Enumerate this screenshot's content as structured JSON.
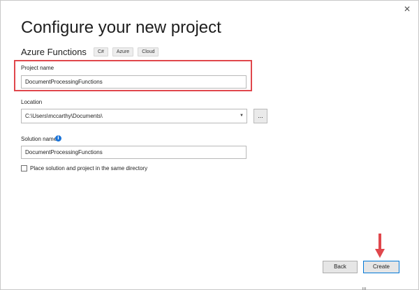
{
  "window": {
    "close_glyph": "✕"
  },
  "header": {
    "title": "Configure your new project",
    "template_name": "Azure Functions",
    "tags": [
      "C#",
      "Azure",
      "Cloud"
    ]
  },
  "form": {
    "project_name": {
      "label": "Project name",
      "value": "DocumentProcessingFunctions"
    },
    "location": {
      "label": "Location",
      "value": "C:\\Users\\mccarthy\\Documents\\",
      "browse_label": "...",
      "dropdown_icon": "chevron-down-icon"
    },
    "solution_name": {
      "label": "Solution name",
      "value": "DocumentProcessingFunctions",
      "info_icon": "info-icon",
      "info_glyph": "i"
    },
    "same_directory": {
      "label": "Place solution and project in the same directory",
      "checked": false
    }
  },
  "footer": {
    "back_label": "Back",
    "create_label": "Create"
  },
  "annotation": {
    "highlight_color": "#e0474c",
    "arrow_color": "#e0474c"
  },
  "colors": {
    "accent": "#0078d7",
    "info": "#1a73d8"
  }
}
